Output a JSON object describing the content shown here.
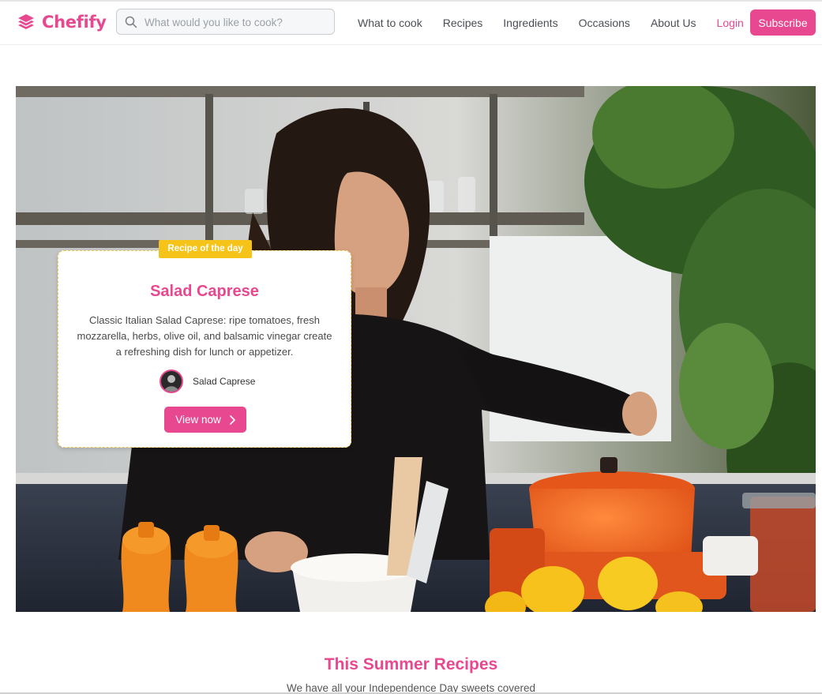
{
  "brand": {
    "name": "Chefify",
    "color": "#e8488f",
    "icon": "layers-icon"
  },
  "search": {
    "placeholder": "What would you like to cook?",
    "value": "",
    "icon": "search-icon"
  },
  "nav": {
    "items": [
      {
        "label": "What to cook"
      },
      {
        "label": "Recipes"
      },
      {
        "label": "Ingredients"
      },
      {
        "label": "Occasions"
      },
      {
        "label": "About Us"
      }
    ],
    "login_label": "Login",
    "subscribe_label": "Subscribe"
  },
  "hero": {
    "badge": "Recipe of the day",
    "title": "Salad Caprese",
    "description": "Classic Italian Salad Caprese: ripe tomatoes, fresh mozzarella, herbs, olive oil, and balsamic vinegar create a refreshing dish for lunch or appetizer.",
    "author": "Salad Caprese",
    "button_label": "View now",
    "button_icon": "chevron-right-icon",
    "badge_color": "#f6c319"
  },
  "section": {
    "title": "This Summer Recipes",
    "subtitle": "We have all your Independence Day sweets covered"
  }
}
